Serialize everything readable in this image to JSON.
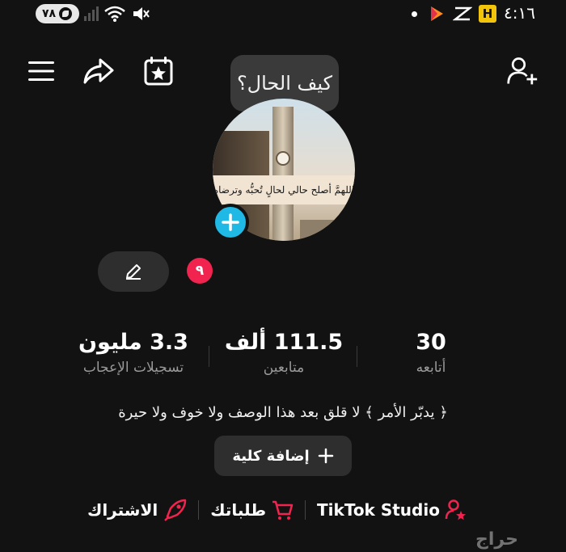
{
  "status_bar": {
    "battery": "٧٨",
    "time": "٤:١٦",
    "h_badge": "H"
  },
  "tooltip": {
    "text": "كيف الحال؟"
  },
  "avatar": {
    "banner_text": "اللهمَّ أصلح حالي لحالٍ تُحبُّه وترضاه"
  },
  "notification_count": "٩",
  "stats": {
    "likes": {
      "value": "3.3 مليون",
      "label": "تسجيلات الإعجاب"
    },
    "followers": {
      "value": "111.5 ألف",
      "label": "متابعين"
    },
    "following": {
      "value": "30",
      "label": "أتابعه"
    }
  },
  "bio": "﴿ يدبّر الأمر ﴾ لا قلق بعد هذا الوصف ولا خوف ولا حيرة",
  "add_bio_label": "إضافة كلية",
  "links": {
    "subscribe": "الاشتراك",
    "orders": "طلباتك",
    "studio": "TikTok Studio"
  },
  "watermark": "حراج",
  "colors": {
    "background": "#121212",
    "accent_blue": "#20b8e4",
    "accent_red": "#f0244f",
    "button_bg": "#2e2e2e"
  },
  "icons": [
    "menu-icon",
    "share-icon",
    "calendar-star-icon",
    "add-user-icon",
    "pencil-icon",
    "plus-icon",
    "cart-icon",
    "rocket-icon",
    "person-star-icon"
  ]
}
